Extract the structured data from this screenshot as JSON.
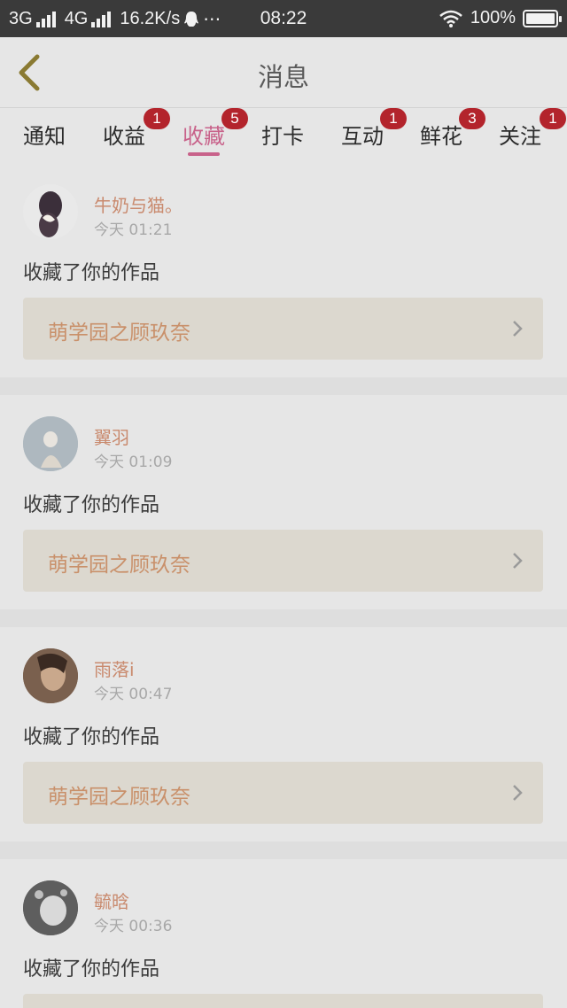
{
  "status_bar": {
    "net1": "3G",
    "net2": "4G",
    "speed": "16.2K/s",
    "notif": "⋯",
    "time": "08:22",
    "battery": "100%"
  },
  "header": {
    "title": "消息"
  },
  "tabs": [
    {
      "label": "通知",
      "badge": ""
    },
    {
      "label": "收益",
      "badge": "1"
    },
    {
      "label": "收藏",
      "badge": "5",
      "active": true
    },
    {
      "label": "打卡",
      "badge": ""
    },
    {
      "label": "互动",
      "badge": "1"
    },
    {
      "label": "鲜花",
      "badge": "3"
    },
    {
      "label": "关注",
      "badge": "1"
    }
  ],
  "messages": [
    {
      "user": "牛奶与猫。",
      "time": "今天 01:21",
      "action": "收藏了你的作品",
      "work": "萌学园之顾玖奈"
    },
    {
      "user": "翼羽",
      "time": "今天 01:09",
      "action": "收藏了你的作品",
      "work": "萌学园之顾玖奈"
    },
    {
      "user": "雨落i",
      "time": "今天 00:47",
      "action": "收藏了你的作品",
      "work": "萌学园之顾玖奈"
    },
    {
      "user": "毓晗",
      "time": "今天 00:36",
      "action": "收藏了你的作品",
      "work": ""
    }
  ],
  "colors": {
    "accent": "#c8628a",
    "badge": "#b3242c",
    "username": "#c98a6e",
    "work_title": "#c9906a"
  }
}
